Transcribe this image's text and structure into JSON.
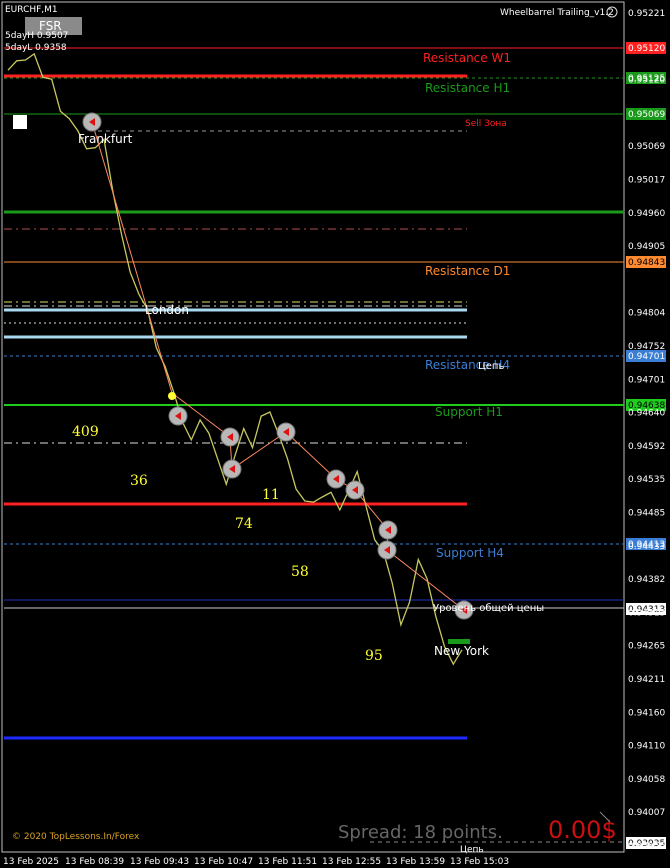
{
  "header": {
    "symbol": "EURCHF,M1",
    "indicator_name": "Wheelbarrel Trailing_v1.2",
    "fsr_button": "FSR",
    "five_day_high": "5dayH 0.9507",
    "five_day_low": "5dayL 0.9358"
  },
  "footer": {
    "copyright": "© 2020 TopLessons.In/Forex",
    "spread": "Spread: 18 points.",
    "profit": "0.00$"
  },
  "colors": {
    "background": "#000000",
    "price_line": "#c8c860",
    "resistance_w1": "#ff2020",
    "resistance_h1": "#1a9a1a",
    "resistance_d1": "#ff8a30",
    "resistance_h4": "#3a7fd5",
    "support_h1": "#1ecc1e",
    "support_h4": "#3a7fd5",
    "sell_zone": "#ff2020",
    "label_yellow": "#ffff33",
    "blue_line": "#1e2aff"
  },
  "chart_data": {
    "type": "line",
    "title": "",
    "ylim": [
      0.93935,
      0.9528
    ],
    "y_ticks": [
      "0.95221",
      "0.95169",
      "0.95117",
      "0.95065",
      "0.95013",
      "0.94961",
      "0.94909",
      "0.94857",
      "0.94805",
      "0.94753",
      "0.94701",
      "0.94649",
      "0.94597",
      "0.94545",
      "0.94493",
      "0.94441",
      "0.94389",
      "0.94337",
      "0.94285",
      "0.94233",
      "0.94181",
      "0.94129",
      "0.94077",
      "0.94025",
      "0.93973"
    ],
    "y_tick_labels": [
      "0.95221",
      "",
      "0.95120",
      "",
      "0.95069",
      "0.95017",
      "0.94960",
      "0.94905",
      "",
      "0.94804",
      "0.94752",
      "0.94701",
      "0.94640",
      "0.94592",
      "0.94535",
      "0.94485",
      "0.94433",
      "0.94382",
      "0.94313",
      "0.94265",
      "0.94211",
      "0.94160",
      "0.94110",
      "0.94058",
      "0.94007",
      "0.93956"
    ],
    "x_tick_labels": [
      "13 Feb 2025",
      "13 Feb 08:39",
      "13 Feb 09:43",
      "13 Feb 10:47",
      "13 Feb 11:51",
      "13 Feb 12:55",
      "13 Feb 13:59",
      "13 Feb 15:03"
    ],
    "levels": [
      {
        "name": "Resistance W1",
        "price": 0.9512,
        "label": "Resistance W1",
        "tag": "0.95120",
        "color": "#ff2020"
      },
      {
        "name": "Resistance H1",
        "price": 0.95085,
        "label": "Resistance H1",
        "tag": "0.95125",
        "color": "#1a9a1a"
      },
      {
        "name": "Sell Zone",
        "price": 0.95069,
        "label": "Sell Зона",
        "tag": "0.95069",
        "color": "#ff2020"
      },
      {
        "name": "Resistance D1",
        "price": 0.94843,
        "label": "Resistance D1",
        "tag": "0.94843",
        "color": "#ff8a30"
      },
      {
        "name": "Resistance H4",
        "price": 0.94701,
        "label": "Resistance H4",
        "tag": "0.94701",
        "color": "#3a7fd5"
      },
      {
        "name": "Support H1",
        "price": 0.94638,
        "label": "Support H1",
        "tag": "0.94638",
        "color": "#1ecc1e"
      },
      {
        "name": "Support H4",
        "price": 0.94413,
        "label": "Support H4",
        "tag": "0.94413",
        "color": "#3a7fd5"
      },
      {
        "name": "Current",
        "price": 0.94313,
        "label": "Уровень общей цены",
        "tag": "0.94313",
        "color": "#ffffff"
      },
      {
        "name": "Bottom",
        "price": 0.93935,
        "label": "",
        "tag": "0.93935",
        "color": "#ffffff"
      }
    ],
    "sessions": [
      "Frankfurt",
      "London",
      "New York"
    ],
    "count_labels": [
      "409",
      "36",
      "74",
      "11",
      "58",
      "95"
    ],
    "price_label": "Цепь",
    "series": [
      {
        "values": [
          0.9518,
          0.952,
          0.9519,
          0.9521,
          0.9517,
          0.9516,
          0.9512,
          0.951,
          0.9508,
          0.9506,
          0.9505,
          0.9507,
          0.9499,
          0.9491,
          0.9486,
          0.9482,
          0.9479,
          0.9474,
          0.947,
          0.9466,
          0.9462,
          0.9458,
          0.9462,
          0.946,
          0.9455,
          0.9452,
          0.9456,
          0.946,
          0.9458,
          0.9462,
          0.9463,
          0.946,
          0.9455,
          0.9451,
          0.9449,
          0.9448,
          0.945,
          0.945,
          0.9447,
          0.9451,
          0.9453,
          0.9448,
          0.9443,
          0.944,
          0.9436,
          0.9429,
          0.9432,
          0.944,
          0.9436,
          0.943,
          0.9426,
          0.9422,
          0.9425
        ]
      }
    ]
  }
}
